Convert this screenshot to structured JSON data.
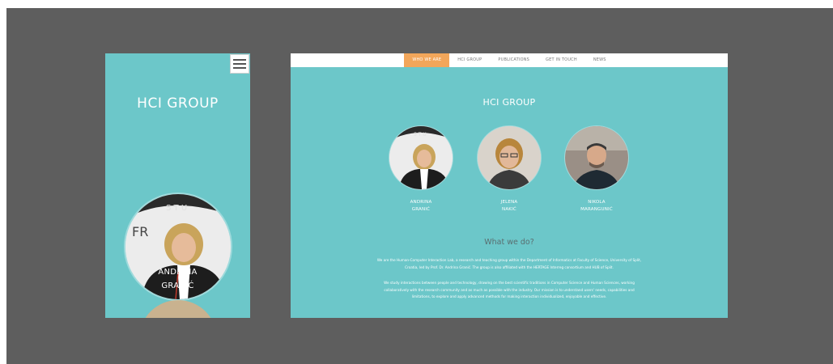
{
  "mobile": {
    "menu_icon": "hamburger-menu-icon",
    "title": "HCI GROUP",
    "person": {
      "first": "ANDRINA",
      "last": "GRANIĆ"
    }
  },
  "desktop": {
    "nav": [
      {
        "label": "WHO WE ARE",
        "active": true
      },
      {
        "label": "HCI GROUP",
        "active": false
      },
      {
        "label": "PUBLICATIONS",
        "active": false
      },
      {
        "label": "GET IN TOUCH",
        "active": false
      },
      {
        "label": "NEWS",
        "active": false
      }
    ],
    "title": "HCI GROUP",
    "people": [
      {
        "first": "ANDRINA",
        "last": "GRANIĆ"
      },
      {
        "first": "JELENA",
        "last": "NAKIĆ"
      },
      {
        "first": "NIKOLA",
        "last": "MARANGUNIĆ"
      }
    ],
    "subtitle": "What we do?",
    "para1": "We are the Human-Computer Interaction Lab, a research and teaching group within the Department of Informatics at Faculty of Science, University of Split, Croatia, led by Prof. Dr. Andrina Granić. The group is also affiliated with the HERTAGE Interreg consortium and HUB of Split.",
    "para2": "We study interactions between people and technology, drawing on the best scientific traditions in Computer Science and Human Sciences, working collaboratively with the research community and as much as possible with the industry. Our mission is to understand users' needs, capabilities and limitations, to explore and apply advanced methods for making interaction individualized, enjoyable and effective."
  },
  "colors": {
    "teal": "#6cc7c9",
    "accent": "#f2a65a",
    "backdrop": "#5e5e5e"
  }
}
